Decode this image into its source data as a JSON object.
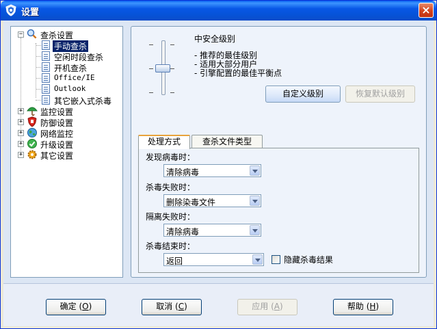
{
  "window": {
    "title": "设置",
    "close_label": "×"
  },
  "tree": {
    "root": {
      "label": "查杀设置",
      "expander": "−"
    },
    "children": [
      {
        "label": "手动查杀",
        "selected": true
      },
      {
        "label": "空闲时段查杀"
      },
      {
        "label": "开机查杀"
      },
      {
        "label": "Office/IE"
      },
      {
        "label": "Outlook"
      },
      {
        "label": "其它嵌入式杀毒"
      }
    ],
    "siblings": [
      {
        "label": "监控设置",
        "expander": "+",
        "icon": "umbrella-icon"
      },
      {
        "label": "防御设置",
        "expander": "+",
        "icon": "shield-icon"
      },
      {
        "label": "网络监控",
        "expander": "+",
        "icon": "globe-icon"
      },
      {
        "label": "升级设置",
        "expander": "+",
        "icon": "update-icon"
      },
      {
        "label": "其它设置",
        "expander": "+",
        "icon": "gear-icon"
      }
    ]
  },
  "level": {
    "title": "中安全级别",
    "lines": [
      "- 推荐的最佳级别",
      "- 适用大部分用户",
      "- 引擎配置的最佳平衡点"
    ],
    "tick_mark": "-",
    "custom_button": "自定义级别",
    "restore_button": "恢复默认级别"
  },
  "tabs": [
    {
      "label": "处理方式",
      "active": true
    },
    {
      "label": "查杀文件类型",
      "active": false
    }
  ],
  "handling": {
    "found_label": "发现病毒时：",
    "found_value": "清除病毒",
    "fail_label": "杀毒失败时：",
    "fail_value": "删除染毒文件",
    "quarantine_label": "隔离失败时：",
    "quarantine_value": "清除病毒",
    "end_label": "杀毒结束时：",
    "end_value": "返回",
    "hide_result_label": "隐藏杀毒结果"
  },
  "footer": {
    "ok": {
      "text": "确定 (",
      "key": "O",
      "tail": ")"
    },
    "cancel": {
      "text": "取消 (",
      "key": "C",
      "tail": ")"
    },
    "apply": {
      "text": "应用 (",
      "key": "A",
      "tail": ")"
    },
    "help": {
      "text": "帮助 (",
      "key": "H",
      "tail": ")"
    }
  }
}
